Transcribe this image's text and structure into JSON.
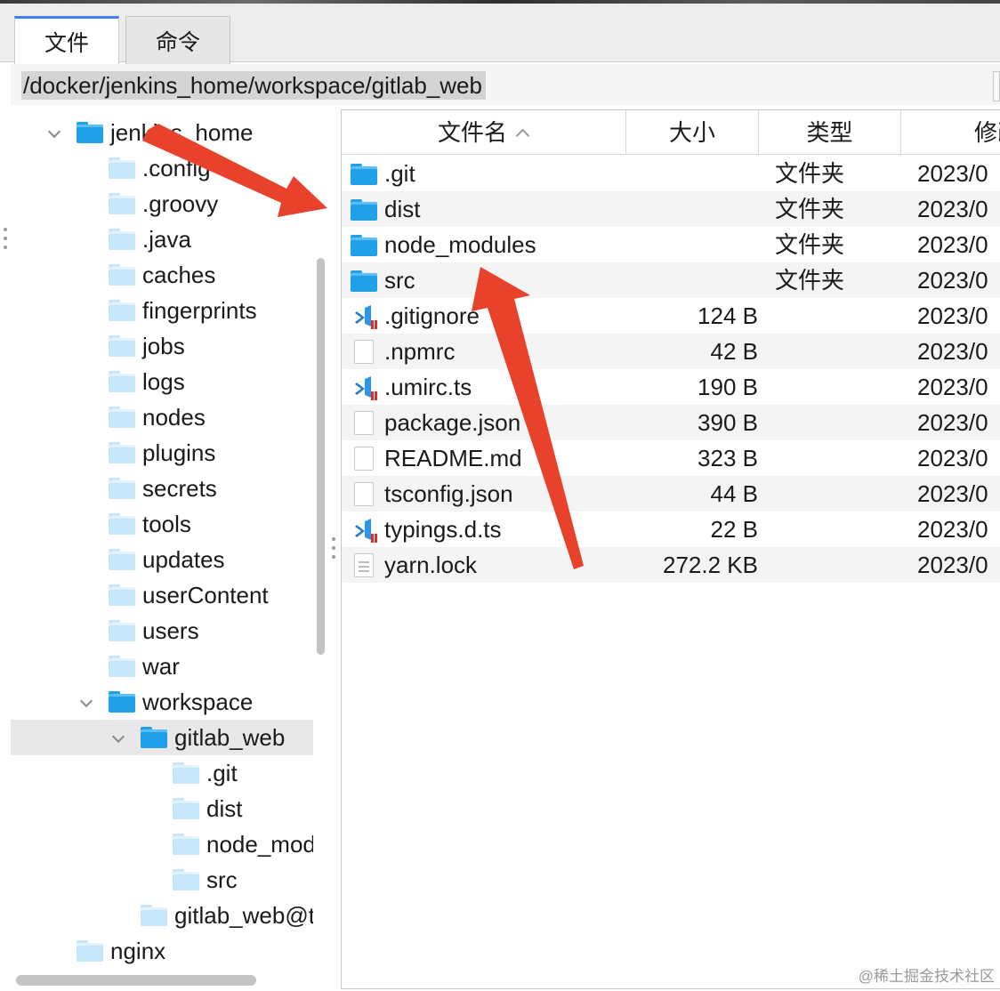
{
  "tabs": [
    {
      "label": "文件",
      "active": true
    },
    {
      "label": "命令",
      "active": false
    }
  ],
  "path": {
    "value": "/docker/jenkins_home/workspace/gitlab_web"
  },
  "tree": {
    "items": [
      {
        "label": "jenkins_home",
        "depth": 0,
        "expanded": true,
        "folder": "dark"
      },
      {
        "label": ".config",
        "depth": 1,
        "folder": "light"
      },
      {
        "label": ".groovy",
        "depth": 1,
        "folder": "light"
      },
      {
        "label": ".java",
        "depth": 1,
        "folder": "light"
      },
      {
        "label": "caches",
        "depth": 1,
        "folder": "light"
      },
      {
        "label": "fingerprints",
        "depth": 1,
        "folder": "light"
      },
      {
        "label": "jobs",
        "depth": 1,
        "folder": "light"
      },
      {
        "label": "logs",
        "depth": 1,
        "folder": "light"
      },
      {
        "label": "nodes",
        "depth": 1,
        "folder": "light"
      },
      {
        "label": "plugins",
        "depth": 1,
        "folder": "light"
      },
      {
        "label": "secrets",
        "depth": 1,
        "folder": "light"
      },
      {
        "label": "tools",
        "depth": 1,
        "folder": "light"
      },
      {
        "label": "updates",
        "depth": 1,
        "folder": "light"
      },
      {
        "label": "userContent",
        "depth": 1,
        "folder": "light"
      },
      {
        "label": "users",
        "depth": 1,
        "folder": "light"
      },
      {
        "label": "war",
        "depth": 1,
        "folder": "light"
      },
      {
        "label": "workspace",
        "depth": 1,
        "expanded": true,
        "folder": "dark"
      },
      {
        "label": "gitlab_web",
        "depth": 2,
        "expanded": true,
        "folder": "dark",
        "selected": true
      },
      {
        "label": ".git",
        "depth": 3,
        "folder": "light"
      },
      {
        "label": "dist",
        "depth": 3,
        "folder": "light"
      },
      {
        "label": "node_modules",
        "depth": 3,
        "folder": "light"
      },
      {
        "label": "src",
        "depth": 3,
        "folder": "light"
      },
      {
        "label": "gitlab_web@tmp",
        "depth": 2,
        "folder": "light"
      },
      {
        "label": "nginx",
        "depth": 0,
        "folder": "light"
      }
    ]
  },
  "table": {
    "columns": [
      {
        "label": "文件名",
        "sorted": "asc"
      },
      {
        "label": "大小"
      },
      {
        "label": "类型"
      },
      {
        "label": "修改时间"
      }
    ],
    "rows": [
      {
        "name": ".git",
        "size": "",
        "type": "文件夹",
        "date": "2023/0",
        "icon": "folder"
      },
      {
        "name": "dist",
        "size": "",
        "type": "文件夹",
        "date": "2023/0",
        "icon": "folder"
      },
      {
        "name": "node_modules",
        "size": "",
        "type": "文件夹",
        "date": "2023/0",
        "icon": "folder"
      },
      {
        "name": "src",
        "size": "",
        "type": "文件夹",
        "date": "2023/0",
        "icon": "folder"
      },
      {
        "name": ".gitignore",
        "size": "124 B",
        "type": "",
        "date": "2023/0",
        "icon": "vscode"
      },
      {
        "name": ".npmrc",
        "size": "42 B",
        "type": "",
        "date": "2023/0",
        "icon": "doc"
      },
      {
        "name": ".umirc.ts",
        "size": "190 B",
        "type": "",
        "date": "2023/0",
        "icon": "vscode"
      },
      {
        "name": "package.json",
        "size": "390 B",
        "type": "",
        "date": "2023/0",
        "icon": "doc"
      },
      {
        "name": "README.md",
        "size": "323 B",
        "type": "",
        "date": "2023/0",
        "icon": "doc"
      },
      {
        "name": "tsconfig.json",
        "size": "44 B",
        "type": "",
        "date": "2023/0",
        "icon": "doc"
      },
      {
        "name": "typings.d.ts",
        "size": "22 B",
        "type": "",
        "date": "2023/0",
        "icon": "vscode"
      },
      {
        "name": "yarn.lock",
        "size": "272.2 KB",
        "type": "",
        "date": "2023/0",
        "icon": "doc-lines"
      }
    ]
  },
  "colors": {
    "accent": "#3b82f6",
    "folder_dark": "#1fa0e8",
    "folder_light": "#c6e6fa",
    "arrow": "#e8412c"
  },
  "watermark": "@稀土掘金技术社区"
}
